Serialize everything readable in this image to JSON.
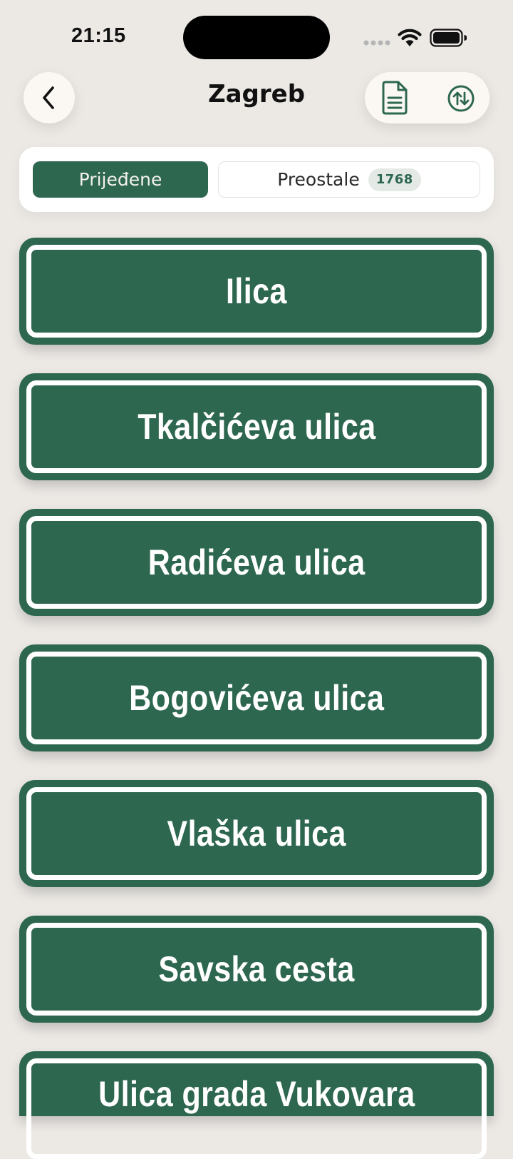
{
  "status_bar": {
    "time": "21:15"
  },
  "header": {
    "title": "Zagreb",
    "back_icon": "chevron-left-icon",
    "document_icon": "document-icon",
    "sort_icon": "sort-arrows-icon"
  },
  "segments": {
    "visited_label": "Prijeđene",
    "remaining_label": "Preostale",
    "remaining_count": "1768",
    "selected": "visited"
  },
  "colors": {
    "sign_green": "#2E6750",
    "background": "#ECE9E5"
  },
  "streets": [
    "Ilica",
    "Tkalčićeva ulica",
    "Radićeva ulica",
    "Bogovićeva ulica",
    "Vlaška ulica",
    "Savska cesta",
    "Ulica grada Vukovara"
  ]
}
